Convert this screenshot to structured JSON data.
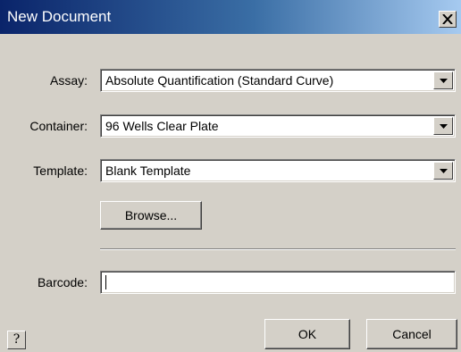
{
  "window": {
    "title": "New Document",
    "close_icon": "close-x-icon"
  },
  "form": {
    "assay": {
      "label": "Assay:",
      "value": "Absolute Quantification (Standard Curve)"
    },
    "container": {
      "label": "Container:",
      "value": "96 Wells Clear Plate"
    },
    "template": {
      "label": "Template:",
      "value": "Blank Template"
    },
    "browse_label": "Browse...",
    "barcode": {
      "label": "Barcode:",
      "value": ""
    }
  },
  "footer": {
    "help_label": "?",
    "ok_label": "OK",
    "cancel_label": "Cancel"
  },
  "colors": {
    "titlebar_start": "#0a246a",
    "titlebar_end": "#a6caf0",
    "dialog_bg": "#d4d0c8"
  }
}
